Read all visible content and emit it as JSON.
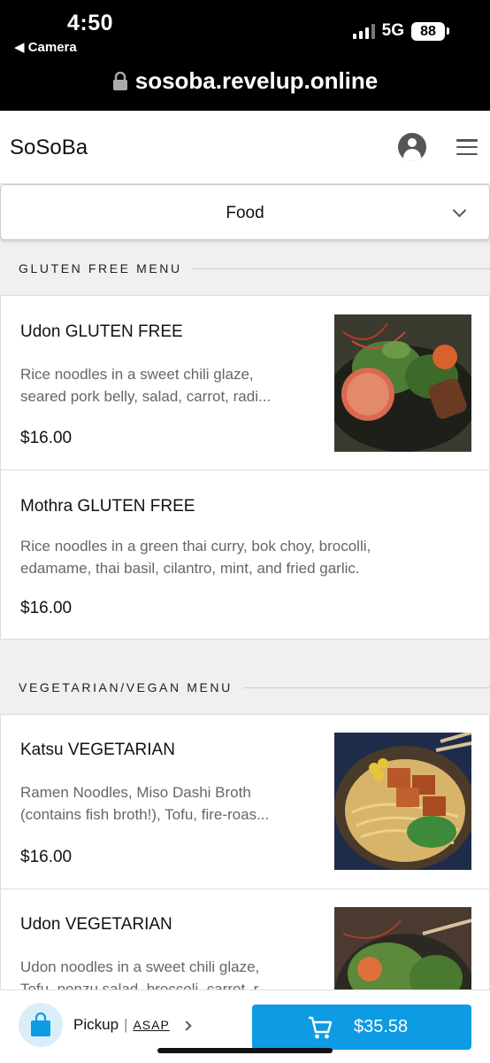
{
  "status_bar": {
    "time": "4:50",
    "back_app": "◀ Camera",
    "network": "5G",
    "battery": "88",
    "url": "sosoba.revelup.online"
  },
  "header": {
    "brand": "SoSoBa"
  },
  "category": {
    "selected": "Food"
  },
  "sections": [
    {
      "title": "GLUTEN FREE MENU",
      "items": [
        {
          "name": "Udon GLUTEN FREE",
          "desc_line1": "Rice noodles in a sweet chili glaze,",
          "desc_line2": "seared pork belly, salad, carrot, radi...",
          "price": "$16.00"
        },
        {
          "name": "Mothra GLUTEN FREE",
          "desc_line1": "Rice noodles in a green thai curry, bok choy, brocolli,",
          "desc_line2": "edamame, thai basil, cilantro, mint, and fried garlic.",
          "price": "$16.00"
        }
      ]
    },
    {
      "title": "VEGETARIAN/VEGAN MENU",
      "items": [
        {
          "name": "Katsu VEGETARIAN",
          "desc_line1": "Ramen Noodles, Miso Dashi Broth",
          "desc_line2": "(contains fish broth!), Tofu, fire-roas...",
          "price": "$16.00"
        },
        {
          "name": "Udon VEGETARIAN",
          "desc_line1": "Udon noodles in a sweet chili glaze,",
          "desc_line2": "Tofu, ponzu salad, broccoli, carrot, r..."
        }
      ]
    }
  ],
  "bottom_bar": {
    "pickup_label": "Pickup",
    "separator": "|",
    "time_label": "ASAP",
    "cart_total": "$35.58"
  },
  "colors": {
    "accent": "#0d9be3",
    "bag_bg": "#d9eef9"
  }
}
